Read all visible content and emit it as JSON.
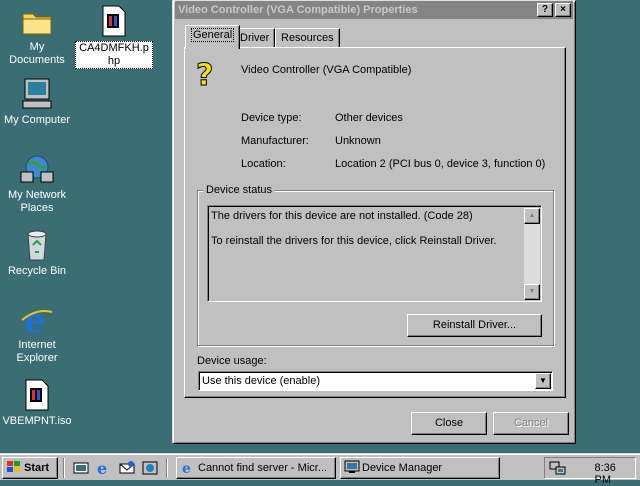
{
  "desktop": {
    "icons": [
      {
        "label": "My Documents"
      },
      {
        "label": "CA4DMFKH.php"
      },
      {
        "label": "My Computer"
      },
      {
        "label": "My Network Places"
      },
      {
        "label": "Recycle Bin"
      },
      {
        "label": "Internet Explorer"
      },
      {
        "label": "VBEMPNT.iso"
      }
    ]
  },
  "dialog": {
    "title": "Video Controller (VGA Compatible) Properties",
    "help_btn": "?",
    "close_btn": "×",
    "tabs": [
      "General",
      "Driver",
      "Resources"
    ],
    "active_tab": "General",
    "device_name": "Video Controller (VGA Compatible)",
    "props": [
      {
        "label": "Device type:",
        "value": "Other devices"
      },
      {
        "label": "Manufacturer:",
        "value": "Unknown"
      },
      {
        "label": "Location:",
        "value": "Location 2 (PCI bus 0, device 3, function 0)"
      }
    ],
    "status_group": "Device status",
    "status_lines": [
      "The drivers for this device are not installed. (Code 28)",
      "To reinstall the drivers for this device, click Reinstall Driver."
    ],
    "reinstall_btn": "Reinstall Driver...",
    "usage_label": "Device usage:",
    "usage_value": "Use this device (enable)",
    "ok_btn": "Close",
    "cancel_btn": "Cancel"
  },
  "taskbar": {
    "start": "Start",
    "tasks": [
      "Cannot find server - Micr...",
      "Device Manager"
    ],
    "clock": "8:36 PM"
  },
  "colors": {
    "desktop": "#3a6e74",
    "face": "#c0c0c0",
    "title_inactive": "#848484"
  }
}
